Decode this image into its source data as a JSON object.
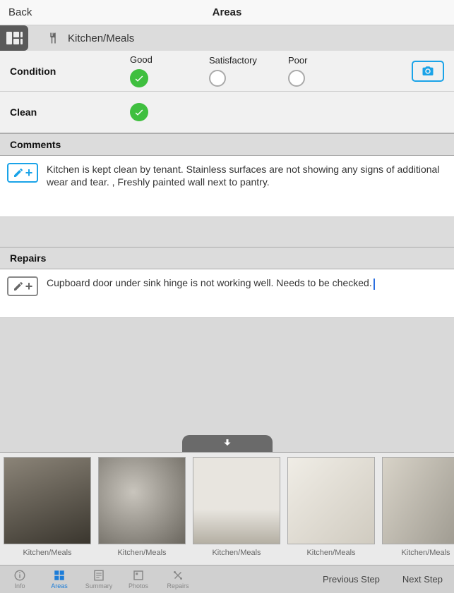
{
  "nav": {
    "back": "Back",
    "title": "Areas"
  },
  "area": {
    "name": "Kitchen/Meals"
  },
  "ratings": {
    "condition_label": "Condition",
    "clean_label": "Clean",
    "options": {
      "good": "Good",
      "satisfactory": "Satisfactory",
      "poor": "Poor"
    }
  },
  "sections": {
    "comments_header": "Comments",
    "comments_text": "Kitchen is kept clean by tenant.  Stainless surfaces are not showing any signs of additional wear and tear. , Freshly painted wall next to pantry.",
    "repairs_header": "Repairs",
    "repairs_text": "Cupboard door under sink hinge is not working well. Needs to be checked."
  },
  "photos": [
    {
      "caption": "Kitchen/Meals"
    },
    {
      "caption": "Kitchen/Meals"
    },
    {
      "caption": "Kitchen/Meals"
    },
    {
      "caption": "Kitchen/Meals"
    },
    {
      "caption": "Kitchen/Meals"
    }
  ],
  "tabs": {
    "info": "Info",
    "areas": "Areas",
    "summary": "Summary",
    "photos": "Photos",
    "repairs": "Repairs"
  },
  "steps": {
    "prev": "Previous Step",
    "next": "Next Step"
  }
}
